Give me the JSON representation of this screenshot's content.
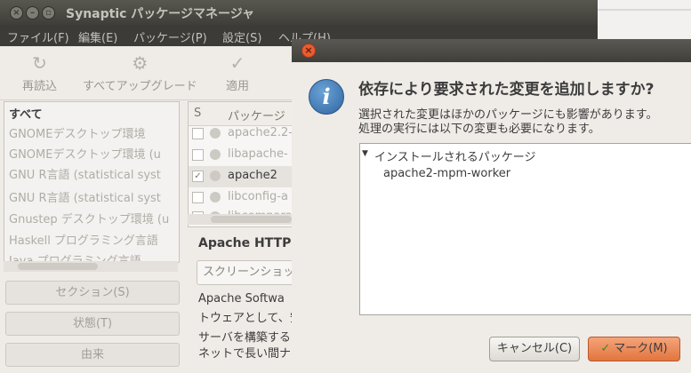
{
  "window": {
    "title": "Synaptic パッケージマネージャ"
  },
  "menubar": [
    "ファイル(F)",
    "編集(E)",
    "パッケージ(P)",
    "設定(S)",
    "ヘルプ(H)"
  ],
  "toolbar": {
    "reload": "再読込",
    "upgrade_all": "すべてアップグレード",
    "apply": "適用"
  },
  "filters": [
    "すべて",
    "GNOMEデスクトップ環境",
    "GNOMEデスクトップ環境 (u",
    "GNU R言語 (statistical syst",
    "GNU R言語 (statistical syst",
    "Gnustep デスクトップ環境 (u",
    "Haskell プログラミング言語",
    "Java プログラミング言語"
  ],
  "side_buttons": {
    "section": "セクション(S)",
    "status": "状態(T)",
    "origin": "由来"
  },
  "package_list": {
    "headers": {
      "s": "S",
      "package": "パッケージ"
    },
    "rows": [
      {
        "name": "apache2.2-",
        "checked": false
      },
      {
        "name": "libapache-",
        "checked": false
      },
      {
        "name": "apache2",
        "checked": true
      },
      {
        "name": "libconfig-a",
        "checked": false
      },
      {
        "name": "libcomparat",
        "checked": false
      }
    ]
  },
  "description": {
    "title": "Apache HTTP",
    "screenshot_button": "スクリーンショッ",
    "lines": [
      "Apache Softwa",
      "トウェアとして、安",
      "サーバを構築する",
      "ネットで長い間ナ"
    ]
  },
  "dialog": {
    "heading": "依存により要求された変更を追加しますか?",
    "body_line1": "選択された変更はほかのパッケージにも影響があります。",
    "body_line2": "処理の実行には以下の変更も必要になります。",
    "tree": {
      "group": "インストールされるパッケージ",
      "items": [
        "apache2-mpm-worker"
      ]
    },
    "cancel": "キャンセル(C)",
    "mark": "マーク(M)"
  }
}
